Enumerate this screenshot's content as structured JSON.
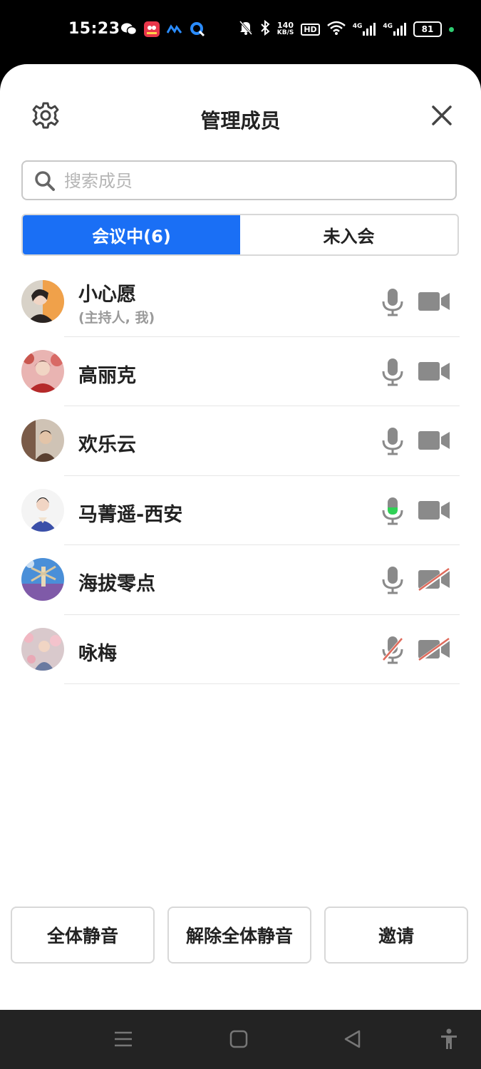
{
  "status_bar": {
    "time": "15:23",
    "speed_value": "140",
    "speed_unit": "KB/S",
    "hd": "HD",
    "network1": "4G",
    "network2": "4G",
    "battery": "81",
    "app_icons": [
      "wechat-icon",
      "app-red-icon",
      "app-blue-icon",
      "app-q-icon"
    ]
  },
  "header": {
    "title": "管理成员"
  },
  "search": {
    "placeholder": "搜索成员"
  },
  "tabs": [
    {
      "label": "会议中(6)",
      "active": true
    },
    {
      "label": "未入会",
      "active": false
    }
  ],
  "members": [
    {
      "name": "小心愿",
      "role": "(主持人, 我)",
      "mic": "on",
      "camera": "on",
      "avatar_color": "#f0a14a"
    },
    {
      "name": "高丽克",
      "role": "",
      "mic": "on",
      "camera": "on",
      "avatar_color": "#c9564e"
    },
    {
      "name": "欢乐云",
      "role": "",
      "mic": "on",
      "camera": "on",
      "avatar_color": "#7a5b48"
    },
    {
      "name": "马菁遥-西安",
      "role": "",
      "mic": "speaking",
      "camera": "on",
      "avatar_color": "#3a4fa8"
    },
    {
      "name": "海拔零点",
      "role": "",
      "mic": "on",
      "camera": "off",
      "avatar_color": "#4a8fd8"
    },
    {
      "name": "咏梅",
      "role": "",
      "mic": "off",
      "camera": "off",
      "avatar_color": "#b9a3a6"
    }
  ],
  "actions": {
    "mute_all": "全体静音",
    "unmute_all": "解除全体静音",
    "invite": "邀请"
  },
  "colors": {
    "accent": "#1a6ff5",
    "speaking": "#2fd155",
    "muted_slash": "#e06b5c",
    "icon_gray": "#8a8a8a"
  }
}
